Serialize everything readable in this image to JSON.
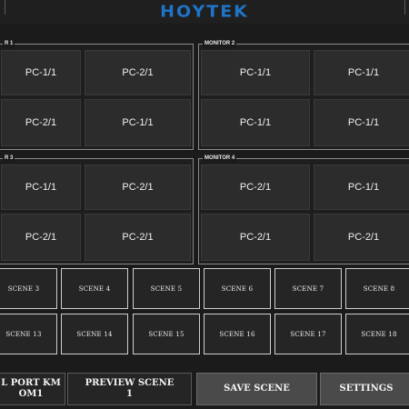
{
  "header": {
    "logo_text": "HOYTEK"
  },
  "monitors": [
    {
      "label": "R 1",
      "cells": [
        "PC-1/1",
        "PC-2/1",
        "PC-2/1",
        "PC-1/1"
      ]
    },
    {
      "label": "MONITOR 2",
      "cells": [
        "PC-1/1",
        "PC-1/1",
        "PC-1/1",
        "PC-1/1"
      ]
    },
    {
      "label": "R 3",
      "cells": [
        "PC-1/1",
        "PC-2/1",
        "PC-2/1",
        "PC-2/1"
      ]
    },
    {
      "label": "MONITOR 4",
      "cells": [
        "PC-2/1",
        "PC-1/1",
        "PC-2/1",
        "PC-2/1"
      ]
    }
  ],
  "scenes": [
    "SCENE 3",
    "SCENE 4",
    "SCENE 5",
    "SCENE 6",
    "SCENE 7",
    "SCENE 8",
    "SCENE 13",
    "SCENE 14",
    "SCENE 15",
    "SCENE 16",
    "SCENE 17",
    "SCENE 18"
  ],
  "bottom": {
    "port_line1": "L PORT KM",
    "port_line2": "OM1",
    "preview_line1": "PREVIEW SCENE",
    "preview_line2": "1",
    "save_label": "SAVE SCENE",
    "settings_label": "SETTINGS"
  },
  "colors": {
    "logo": "#1f74c8",
    "background": "#1b1b1b",
    "cell": "#2c2c2c"
  }
}
